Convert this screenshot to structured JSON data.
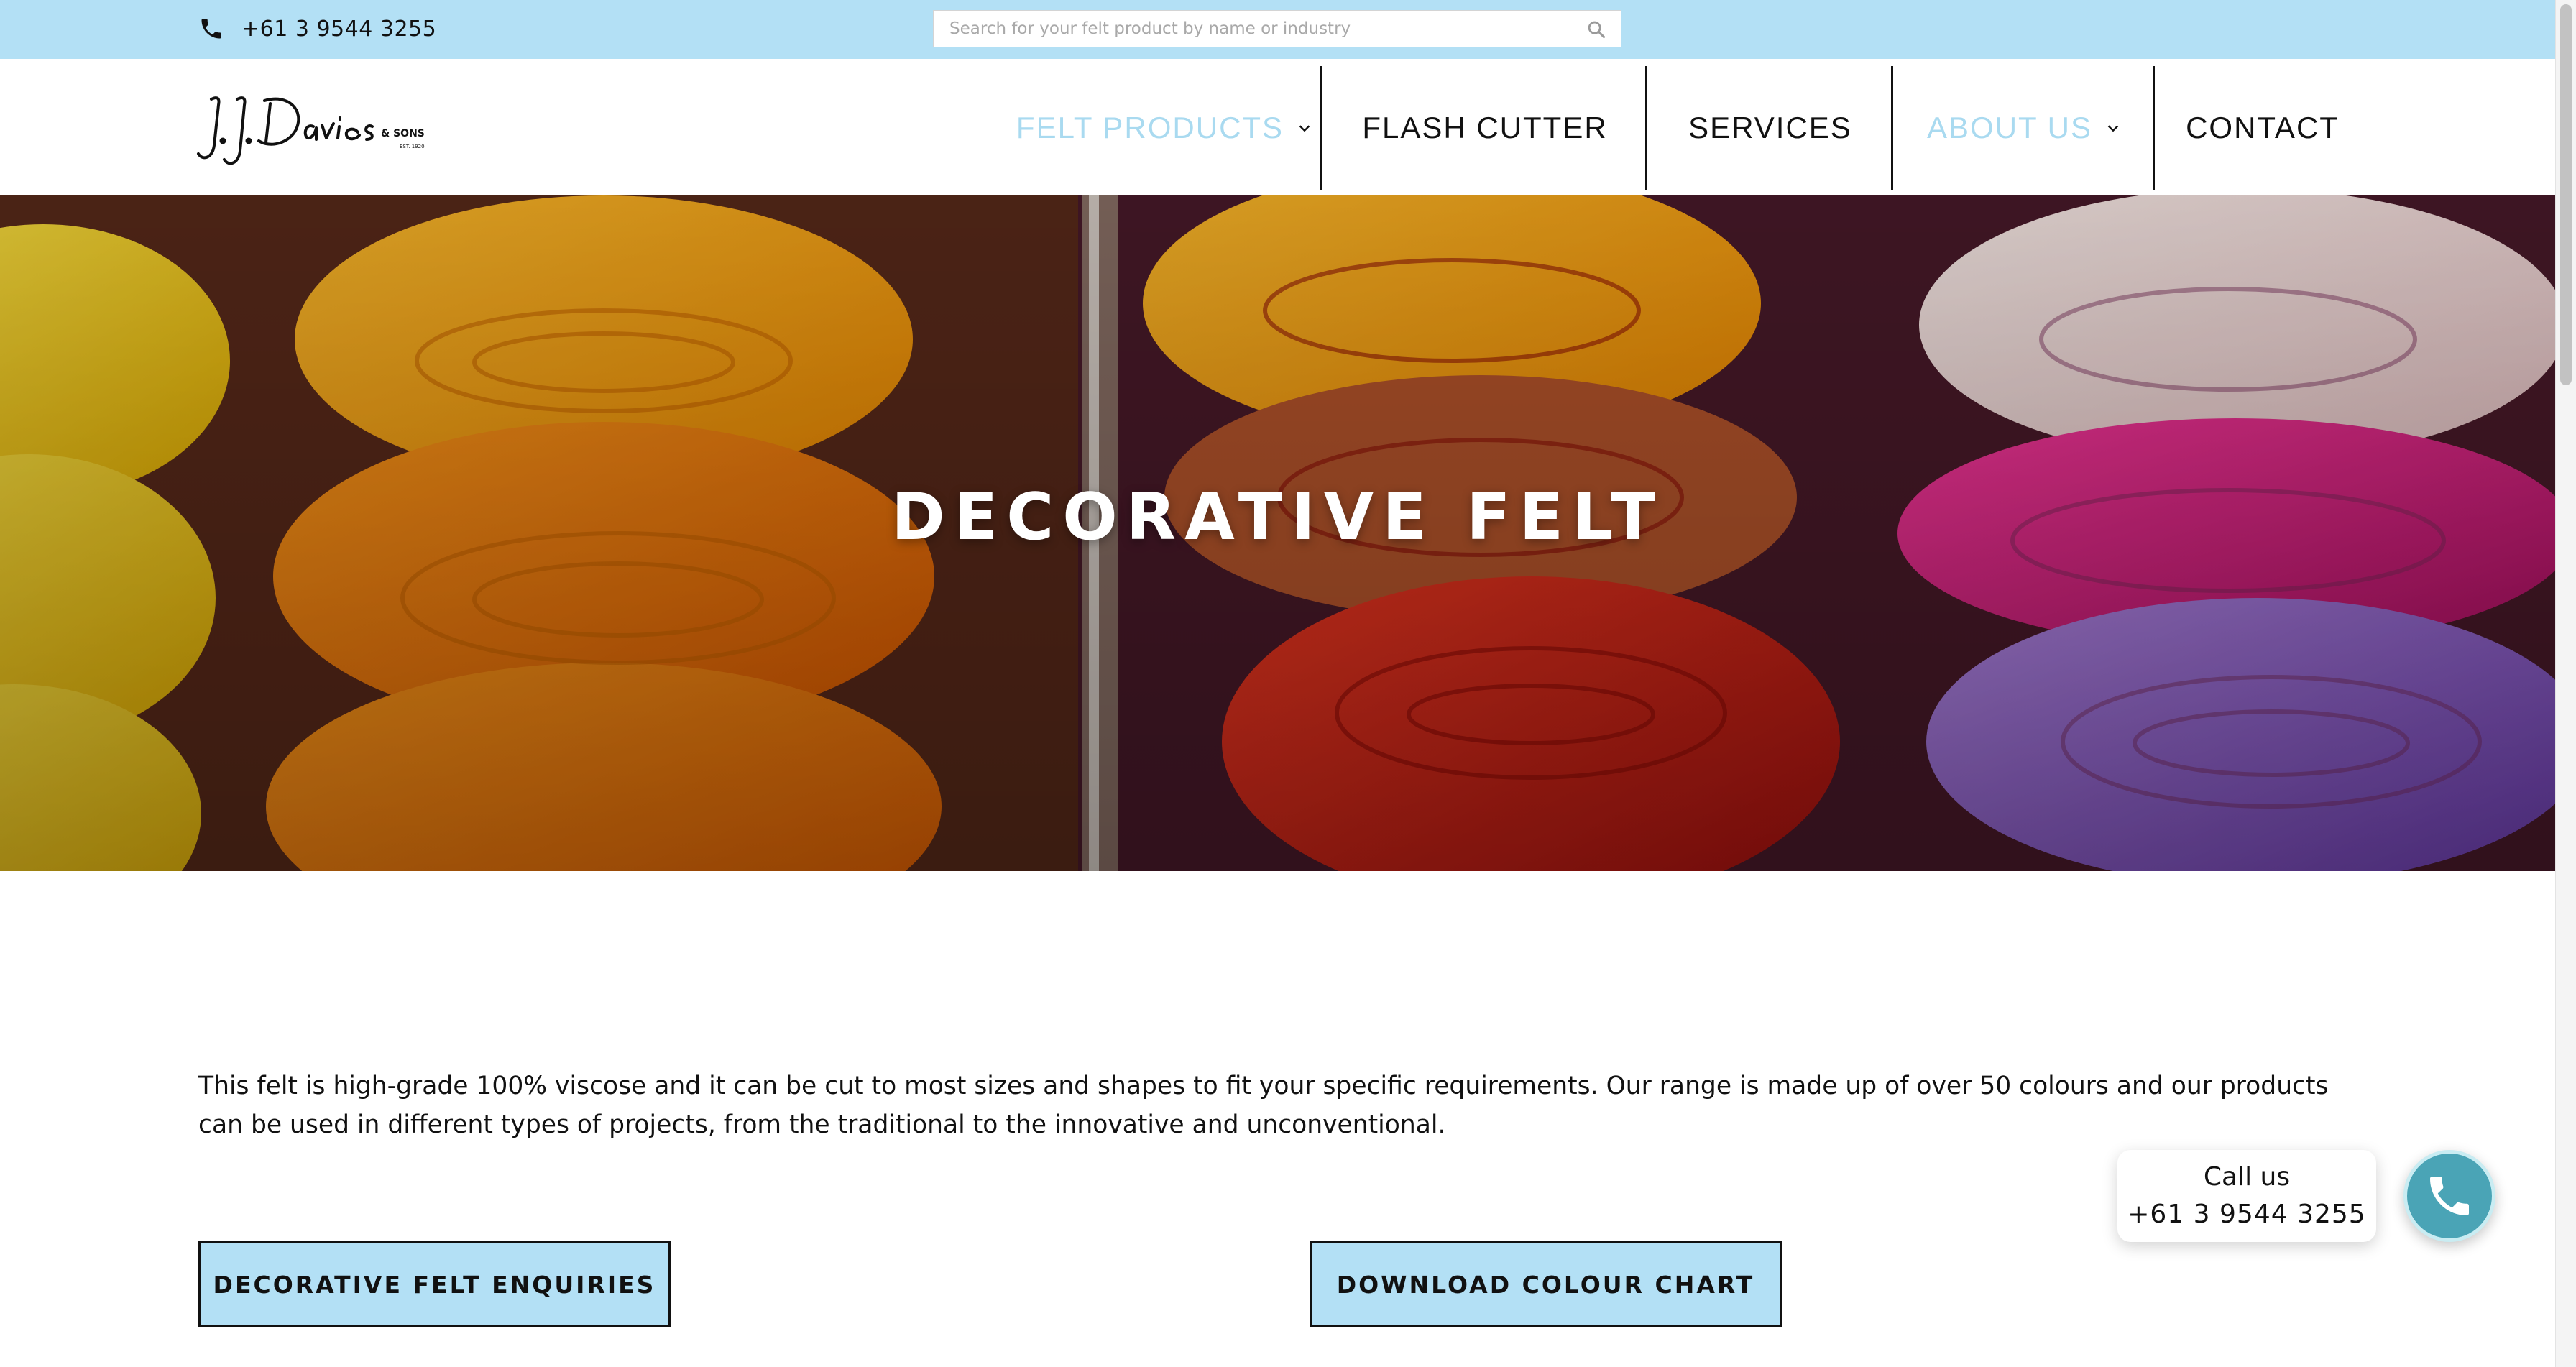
{
  "topbar": {
    "phone": "+61 3 9544 3255",
    "search_placeholder": "Search for your felt product by name or industry",
    "background": "#b3e0f5"
  },
  "logo": {
    "name": "J.J.Davies",
    "suffix": "& SONS",
    "est": "EST. 1920"
  },
  "nav": {
    "items": [
      {
        "label": "FELT PRODUCTS",
        "has_dropdown": true,
        "active": true
      },
      {
        "label": "FLASH CUTTER",
        "has_dropdown": false,
        "active": false
      },
      {
        "label": "SERVICES",
        "has_dropdown": false,
        "active": false
      },
      {
        "label": "ABOUT US",
        "has_dropdown": true,
        "active": true
      },
      {
        "label": "CONTACT",
        "has_dropdown": false,
        "active": false
      }
    ],
    "active_color": "#a9daf0"
  },
  "hero": {
    "title": "DECORATIVE FELT"
  },
  "content": {
    "intro": "This felt is high-grade 100% viscose and it can be cut to most sizes and shapes to fit your specific requirements. Our range is made up of over 50 colours and our products can be used in different types of projects, from the traditional to the innovative and unconventional.",
    "buttons": {
      "enquiries": "DECORATIVE FELT ENQUIRIES",
      "colour_chart": "DOWNLOAD COLOUR CHART"
    }
  },
  "call_widget": {
    "line1": "Call us",
    "line2": "+61 3 9544 3255",
    "color": "#4aa4b6"
  },
  "icons": [
    "phone-icon",
    "search-icon",
    "chevron-down-icon",
    "call-phone-icon"
  ]
}
